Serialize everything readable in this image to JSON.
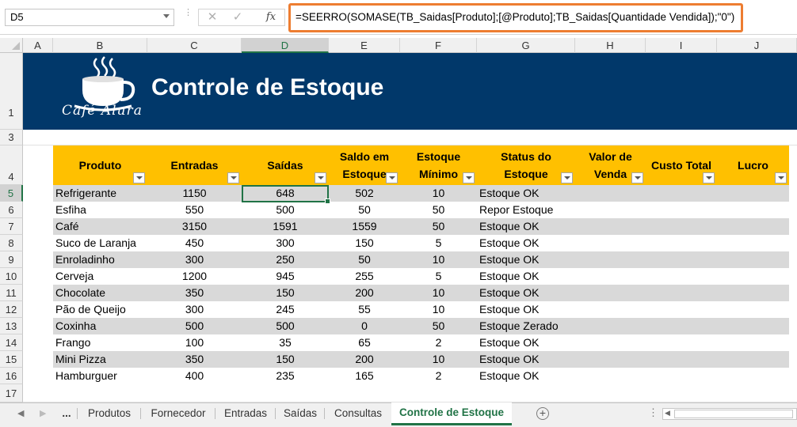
{
  "name_box": "D5",
  "formula": "=SEERRO(SOMASE(TB_Saidas[Produto];[@Produto];TB_Saidas[Quantidade Vendida]);\"0\")",
  "formula_buttons": {
    "cancel": "✕",
    "enter": "✓",
    "function": "fx"
  },
  "columns": [
    "A",
    "B",
    "C",
    "D",
    "E",
    "F",
    "G",
    "H",
    "I",
    "J"
  ],
  "rows": [
    "1",
    "3",
    "4",
    "5",
    "6",
    "7",
    "8",
    "9",
    "10",
    "11",
    "12",
    "13",
    "14",
    "15",
    "16",
    "17"
  ],
  "banner": {
    "logo_text": "Café Alura",
    "title": "Controle de Estoque"
  },
  "table": {
    "headers": [
      {
        "line1": "Produto",
        "line2": ""
      },
      {
        "line1": "Entradas",
        "line2": ""
      },
      {
        "line1": "Saídas",
        "line2": ""
      },
      {
        "line1": "Saldo em",
        "line2": "Estoque"
      },
      {
        "line1": "Estoque",
        "line2": "Mínimo"
      },
      {
        "line1": "Status do",
        "line2": "Estoque"
      },
      {
        "line1": "Valor de",
        "line2": "Venda"
      },
      {
        "line1": "Custo Total",
        "line2": ""
      },
      {
        "line1": "Lucro",
        "line2": ""
      }
    ],
    "rows": [
      {
        "produto": "Refrigerante",
        "entradas": "1150",
        "saidas": "648",
        "saldo": "502",
        "minimo": "10",
        "status": "Estoque OK"
      },
      {
        "produto": "Esfiha",
        "entradas": "550",
        "saidas": "500",
        "saldo": "50",
        "minimo": "50",
        "status": "Repor Estoque"
      },
      {
        "produto": "Café",
        "entradas": "3150",
        "saidas": "1591",
        "saldo": "1559",
        "minimo": "50",
        "status": "Estoque OK"
      },
      {
        "produto": "Suco de Laranja",
        "entradas": "450",
        "saidas": "300",
        "saldo": "150",
        "minimo": "5",
        "status": "Estoque OK"
      },
      {
        "produto": "Enroladinho",
        "entradas": "300",
        "saidas": "250",
        "saldo": "50",
        "minimo": "10",
        "status": "Estoque OK"
      },
      {
        "produto": "Cerveja",
        "entradas": "1200",
        "saidas": "945",
        "saldo": "255",
        "minimo": "5",
        "status": "Estoque OK"
      },
      {
        "produto": "Chocolate",
        "entradas": "350",
        "saidas": "150",
        "saldo": "200",
        "minimo": "10",
        "status": "Estoque OK"
      },
      {
        "produto": "Pão de Queijo",
        "entradas": "300",
        "saidas": "245",
        "saldo": "55",
        "minimo": "10",
        "status": "Estoque OK"
      },
      {
        "produto": "Coxinha",
        "entradas": "500",
        "saidas": "500",
        "saldo": "0",
        "minimo": "50",
        "status": "Estoque Zerado"
      },
      {
        "produto": "Frango",
        "entradas": "100",
        "saidas": "35",
        "saldo": "65",
        "minimo": "2",
        "status": "Estoque OK"
      },
      {
        "produto": "Mini Pizza",
        "entradas": "350",
        "saidas": "150",
        "saldo": "200",
        "minimo": "10",
        "status": "Estoque OK"
      },
      {
        "produto": "Hamburguer",
        "entradas": "400",
        "saidas": "235",
        "saldo": "165",
        "minimo": "2",
        "status": "Estoque OK"
      }
    ]
  },
  "sheet_tabs": {
    "ellipsis": "...",
    "tabs": [
      "Produtos",
      "Fornecedor",
      "Entradas",
      "Saídas",
      "Consultas",
      "Controle de Estoque"
    ],
    "active": "Controle de Estoque",
    "add": "+"
  },
  "colors": {
    "banner": "#01386a",
    "header": "#ffc000",
    "band": "#d9d9d9",
    "accent": "#217346",
    "formula_highlight": "#ed7d31"
  }
}
